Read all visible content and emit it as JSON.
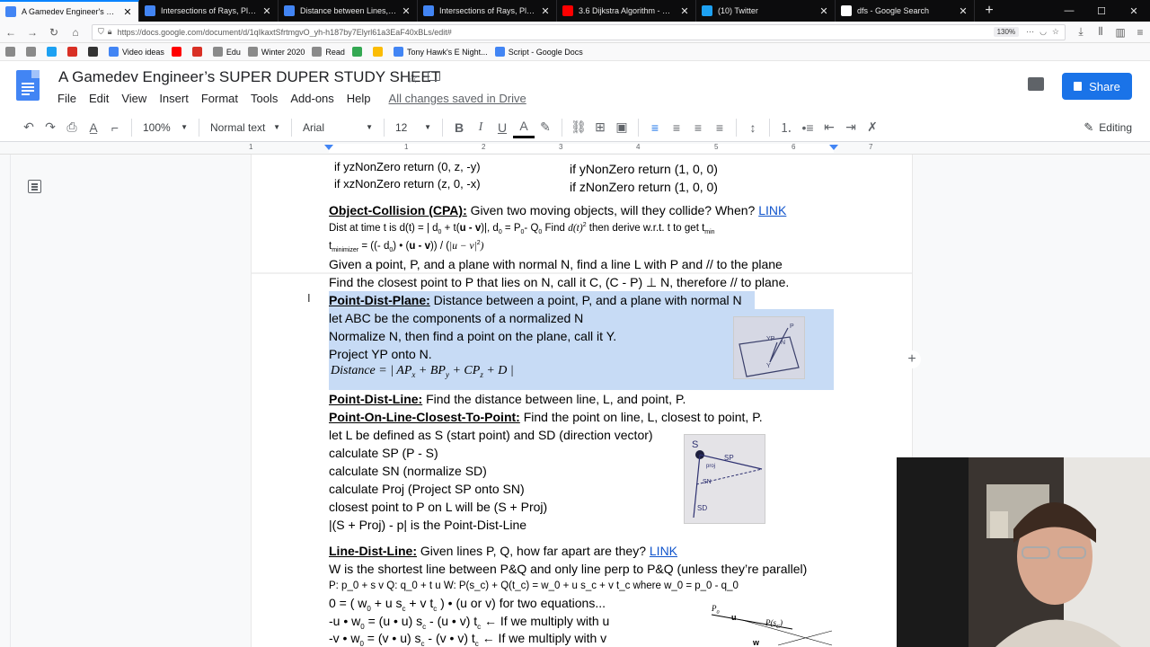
{
  "browser": {
    "tabs": [
      {
        "title": "A Gamedev Engineer's SUPER D",
        "active": true,
        "favicon": "docs-icon",
        "color": "#4285f4"
      },
      {
        "title": "Intersections of Rays, Planes an",
        "active": false,
        "favicon": "page-icon",
        "color": "#4285f4"
      },
      {
        "title": "Distance between Lines, Segme",
        "active": false,
        "favicon": "page-icon",
        "color": "#4285f4"
      },
      {
        "title": "Intersections of Rays, Planes an",
        "active": false,
        "favicon": "page-icon",
        "color": "#4285f4"
      },
      {
        "title": "3.6 Dijkstra Algorithm - Single",
        "active": false,
        "favicon": "youtube-icon",
        "color": "#ff0000"
      },
      {
        "title": "(10) Twitter",
        "active": false,
        "favicon": "twitter-icon",
        "color": "#1da1f2"
      },
      {
        "title": "dfs - Google Search",
        "active": false,
        "favicon": "google-icon",
        "color": "#ffffff"
      }
    ],
    "new_tab": "+",
    "url": "https://docs.google.com/document/d/1qIkaxtSfrtmgvO_yh-h187by7Elyrl61a3EaF40xBLs/edit#",
    "zoom": "130%",
    "bookmarks": [
      {
        "label": "",
        "icon": "folder-icon",
        "color": "#8a8a8a"
      },
      {
        "label": "",
        "icon": "folder-icon",
        "color": "#8a8a8a"
      },
      {
        "label": "",
        "icon": "twitter-icon",
        "color": "#1da1f2"
      },
      {
        "label": "",
        "icon": "gmail-icon",
        "color": "#d93025"
      },
      {
        "label": "",
        "icon": "app-icon",
        "color": "#333333"
      },
      {
        "label": "Video ideas",
        "icon": "docs-icon",
        "color": "#4285f4"
      },
      {
        "label": "",
        "icon": "youtube-icon",
        "color": "#ff0000"
      },
      {
        "label": "",
        "icon": "app-icon",
        "color": "#d93025"
      },
      {
        "label": "Edu",
        "icon": "folder-icon",
        "color": "#8a8a8a"
      },
      {
        "label": "Winter 2020",
        "icon": "folder-icon",
        "color": "#8a8a8a"
      },
      {
        "label": "Read",
        "icon": "folder-icon",
        "color": "#8a8a8a"
      },
      {
        "label": "",
        "icon": "app-icon",
        "color": "#34a853"
      },
      {
        "label": "",
        "icon": "app-icon",
        "color": "#fbbc04"
      },
      {
        "label": "Tony Hawk's E Night...",
        "icon": "docs-icon",
        "color": "#4285f4"
      },
      {
        "label": "Script - Google Docs",
        "icon": "docs-icon",
        "color": "#4285f4"
      }
    ]
  },
  "docs": {
    "title": "A Gamedev Engineer’s SUPER DUPER STUDY SHEET",
    "menu": [
      "File",
      "Edit",
      "View",
      "Insert",
      "Format",
      "Tools",
      "Add-ons",
      "Help"
    ],
    "saved_status": "All changes saved in Drive",
    "share_label": "Share",
    "toolbar": {
      "zoom": "100%",
      "style": "Normal text",
      "font": "Arial",
      "size": "12",
      "mode": "Editing"
    },
    "ruler_numbers": [
      "1",
      "1",
      "2",
      "3",
      "4",
      "5",
      "6",
      "7"
    ],
    "accent_color": "#1a73e8",
    "selection_color": "#c7dbf5"
  },
  "content": {
    "lines_top": [
      {
        "left": "if yzNonZero return (0, z, -y)",
        "right": "if yNonZero return (1, 0, 0)"
      },
      {
        "left": "if xzNonZero return (z, 0, -x)",
        "right": "if zNonZero return (1, 0, 0)"
      }
    ],
    "cpa": {
      "heading": "Object-Collision (CPA):",
      "text": " Given two moving objects, will they collide? When? ",
      "link": "LINK",
      "line1a": "Dist at time t is d(t) = | d",
      "line1b": " + t(",
      "line1c": "u - v",
      "line1d": ")|, d",
      "line1e": " = P",
      "line1f": "- Q",
      "line1g": " Find ",
      "line1h": "d(t)",
      "line1i": "2",
      "line1j": " then derive w.r.t. t to get t",
      "line1k": "min",
      "line2a": "t",
      "line2b": "minimizer",
      "line2c": " = ((- d",
      "line2d": ") • (",
      "line2e": "u - v",
      "line2f": ")) / (",
      "line2g": "|u − v|",
      "line2h": "2",
      "line2i": ")",
      "sub0": "0"
    },
    "plane_line": "Given a point, P, and a plane with normal N, find a line L with P and // to the plane",
    "closest_line": "Find the closest point to P that lies on N, call it C, (C - P) ⊥ N, therefore // to plane.",
    "pdp": {
      "heading": "Point-Dist-Plane:",
      "text": " Distance between a point, P, and a plane with normal N",
      "l1": "let ABC be the components of a normalized N",
      "l2": "Normalize N, then find a point on the plane, call it Y.",
      "l3": "Project YP onto N.",
      "formula": "Distance  = | AP",
      "formula_x": "x",
      "formula_b": " + BP",
      "formula_y": "y",
      "formula_c": " + CP",
      "formula_z": "z",
      "formula_d": " +  D |"
    },
    "pdl": {
      "heading": "Point-Dist-Line:",
      "text": " Find the distance between line, L, and point, P."
    },
    "polc": {
      "heading": "Point-On-Line-Closest-To-Point:",
      "text": " Find the point on line, L, closest to point, P.",
      "steps": [
        "let L be defined as S (start point) and SD (direction vector)",
        "calculate SP (P - S)",
        "calculate SN (normalize SD)",
        "calculate Proj (Project SP onto SN)",
        "closest point to P on L will be (S + Proj)",
        "|(S + Proj) - p| is the Point-Dist-Line"
      ]
    },
    "ldl": {
      "heading": "Line-Dist-Line:",
      "text": " Given lines P, Q, how far apart are they? ",
      "link": "LINK",
      "l1": "W is the shortest line between P&Q and only line perp to P&Q (unless they’re parallel)",
      "l2": "P: p_0 + s v    Q: q_0 + t u    W: P(s_c) + Q(t_c) = w_0 + u s_c + v t_c where  w_0 = p_0 - q_0",
      "l3": "0 = ( w",
      "l3b": " + u s",
      "l3c": " + v t",
      "l3d": " ) • (u or v) for two equations...",
      "l4": "-u • w",
      "l4b": " = (u • u) s",
      "l4c": " - (u • v) t",
      "l4d": " ← If we multiply with u",
      "l5": "-v • w",
      "l5b": " = (v • u) s",
      "l5c": " - (v • v) t",
      "l5d": " ← If we multiply with v",
      "sub0": "0",
      "subc": "c"
    },
    "sketch_labels": {
      "s1_yp": "YP",
      "s1_n": "N",
      "s1_p": "P",
      "s1_y": "Y",
      "s2_s": "S",
      "s2_sp": "SP",
      "s2_proj": "proj",
      "s2_sn": "SN",
      "s2_sd": "SD",
      "s3_p0": "P",
      "s3_sub": "0",
      "s3_u": "u",
      "s3_ps": "P(s",
      "s3_c": "C",
      "s3_close": ")",
      "s3_w": "w"
    }
  }
}
